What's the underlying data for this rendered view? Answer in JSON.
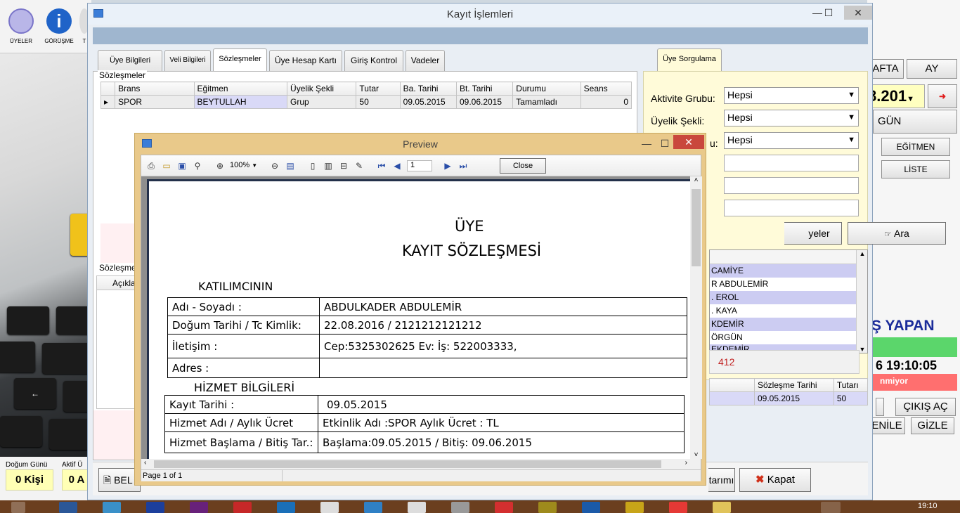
{
  "bg_toolbar": {
    "btn_members": "ÜYELER",
    "btn_meeting": "GÖRÜŞME",
    "btn_partial": "T"
  },
  "bg_stats": {
    "birthday_label": "Doğum Günü",
    "birthday_value": "0 Kişi",
    "active_label": "Aktif Ü",
    "active_value": "0 A"
  },
  "bg_right": {
    "week_btn": "AFTA",
    "month_btn": "AY",
    "date_partial": "8.201",
    "day_btn": "GÜN",
    "trainer_btn": "EĞİTMEN",
    "list_btn": "LİSTE",
    "login_header": "Ş YAPAN",
    "time_text": "6 19:10:05",
    "status_text": "nmiyor",
    "exit_btn": "ÇIKIŞ AÇ",
    "refresh_btn": "ENİLE",
    "hide_btn": "GİZLE"
  },
  "window": {
    "title": "Kayıt İşlemleri",
    "minimize": "—",
    "maximize": "☐",
    "close": "✕"
  },
  "tabs": [
    {
      "label": "Üye Bilgileri"
    },
    {
      "label": "Veli Bilgileri"
    },
    {
      "label": "Sözleşmeler"
    },
    {
      "label": "Üye Hesap Kartı"
    },
    {
      "label": "Giriş Kontrol"
    },
    {
      "label": "Vadeler"
    }
  ],
  "search_tab": "Üye Sorgulama",
  "contracts": {
    "group_label": "Sözleşmeler",
    "columns": [
      "Brans",
      "Eğitmen",
      "Üyelik Şekli",
      "Tutar",
      "Ba. Tarihi",
      "Bt. Tarihi",
      "Durumu",
      "Seans"
    ],
    "rows": [
      {
        "brans": "SPOR",
        "egitmen": "BEYTULLAH",
        "uyelik": "Grup",
        "tutar": "50",
        "ba": "09.05.2015",
        "bt": "09.06.2015",
        "durum": "Tamamladı",
        "seans": "0"
      }
    ]
  },
  "contract_details": {
    "group_label": "Sözleşme",
    "col_desc": "Açıkla"
  },
  "search": {
    "activity_label": "Aktivite Grubu:",
    "activity_value": "Hepsi",
    "membership_label": "Üyelik Şekli:",
    "membership_value": "Hepsi",
    "third_label_partial": "u:",
    "third_value": "Hepsi",
    "all_members_partial": "yeler",
    "search_btn": "Ara",
    "results": [
      "CAMİYE",
      "R ABDULEMİR",
      ". EROL",
      ". KAYA",
      "KDEMİR",
      "ÖRGÜN",
      "EKDEMİR"
    ],
    "count": "412"
  },
  "payments": {
    "col_date": "Sözleşme Tarihi",
    "col_amount": "Tutarı",
    "row_date": "09.05.2015",
    "row_amount": "50"
  },
  "bottom": {
    "left_btn_partial": "BEL",
    "middle_btn_partial": "tarımı",
    "close_btn": "Kapat"
  },
  "preview": {
    "title": "Preview",
    "zoom": "100%",
    "page_input": "1",
    "close_btn": "Close",
    "status": "Page 1 of 1"
  },
  "doc": {
    "title1": "ÜYE",
    "title2": "KAYIT SÖZLEŞMESİ",
    "section1": "KATILIMCININ",
    "name_label": "Adı - Soyadı :",
    "name_value": "ABDULKADER ABDULEMİR",
    "birth_label": "Doğum Tarihi / Tc Kimlik:",
    "birth_value": "22.08.2016  /  2121212121212",
    "contact_label": "İletişim :",
    "contact_value": "Cep:5325302625  Ev:    İş: 522003333,",
    "address_label": "Adres :",
    "address_value": "",
    "section2": "HİZMET BİLGİLERİ",
    "reg_label": "Kayıt Tarihi :",
    "reg_value": "09.05.2015",
    "service_label": "Hizmet Adı  /  Aylık Ücret",
    "service_value": "Etkinlik Adı :SPOR   Aylık Ücret :  TL",
    "dates_label": "Hizmet Başlama / Bitiş Tar.:",
    "dates_value": "Başlama:09.05.2015   /  Bitiş: 09.06.2015"
  },
  "taskbar": {
    "clock": "19:10"
  }
}
